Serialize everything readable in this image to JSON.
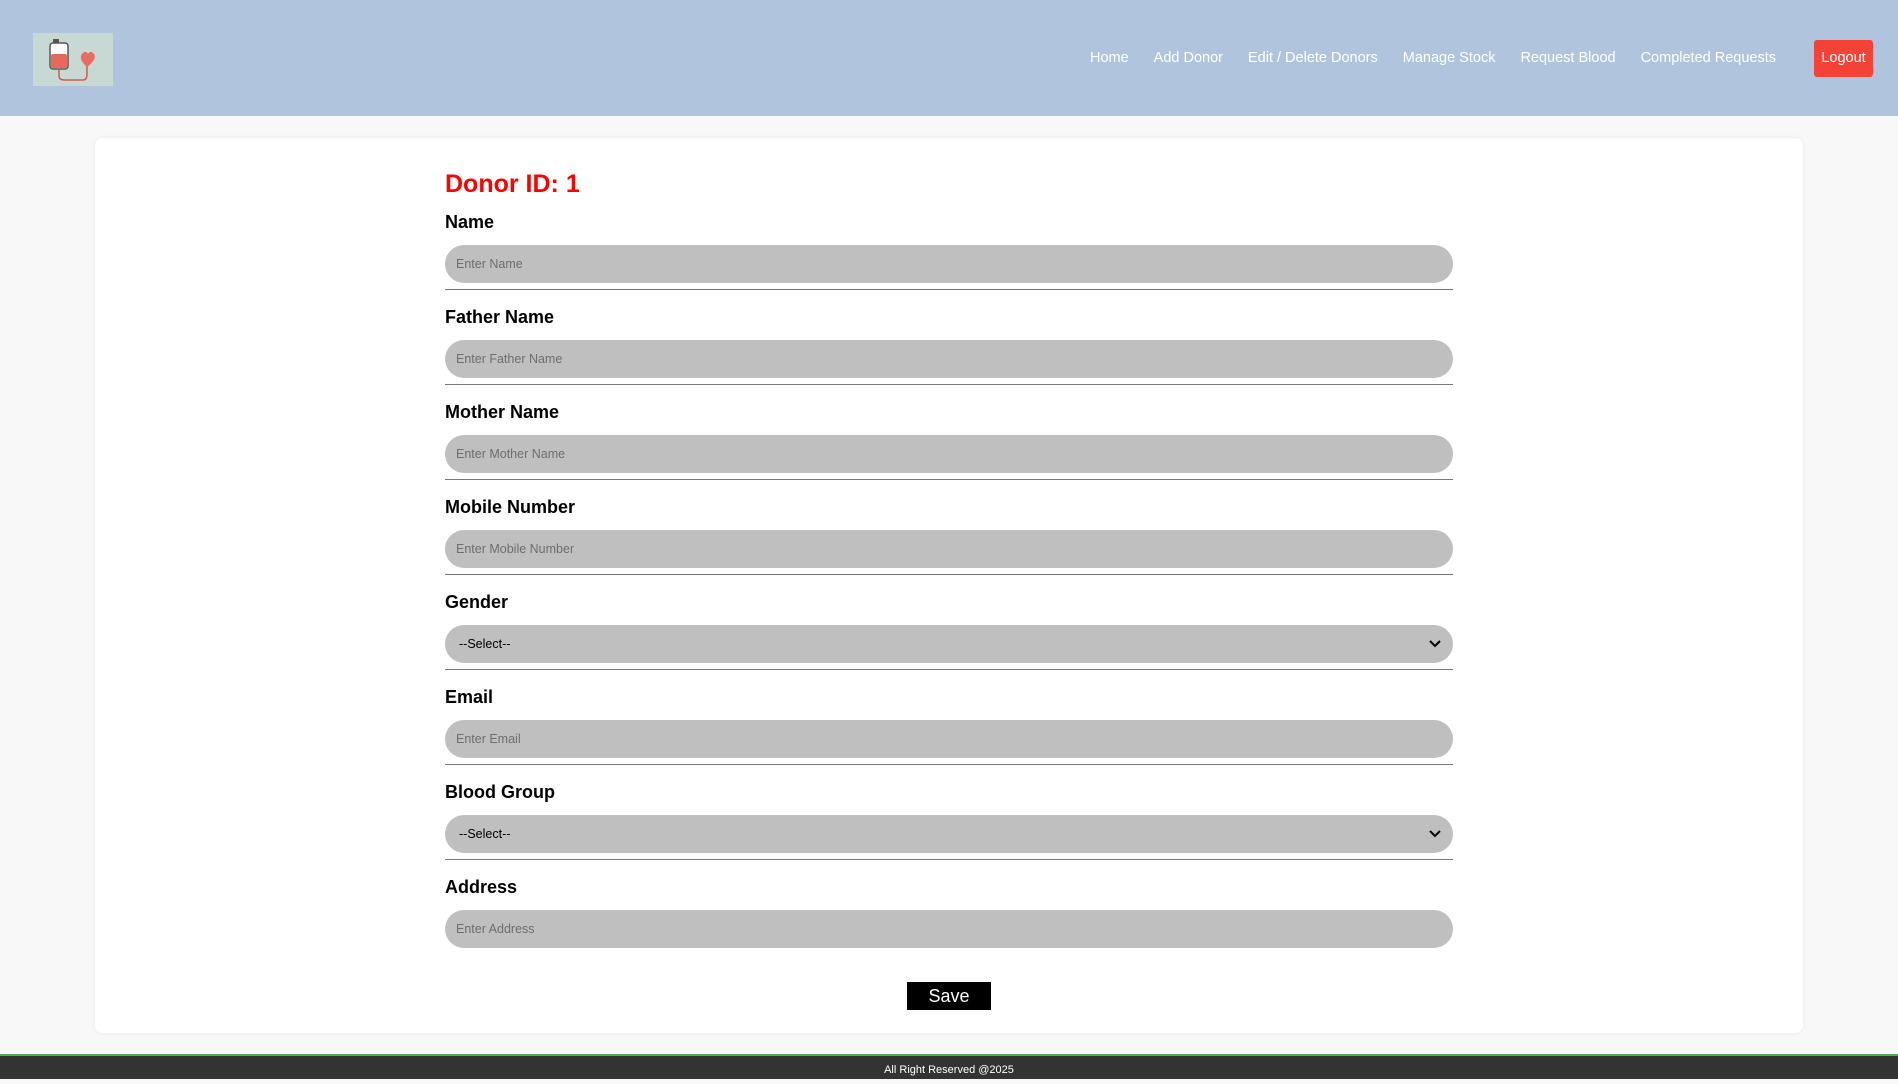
{
  "nav": {
    "items": [
      "Home",
      "Add Donor",
      "Edit / Delete Donors",
      "Manage Stock",
      "Request Blood",
      "Completed Requests"
    ],
    "logout_label": "Logout"
  },
  "form": {
    "donor_id": "Donor ID: 1",
    "fields": [
      {
        "label": "Name",
        "placeholder": "Enter Name",
        "type": "input"
      },
      {
        "label": "Father Name",
        "placeholder": "Enter Father Name",
        "type": "input"
      },
      {
        "label": "Mother Name",
        "placeholder": "Enter Mother Name",
        "type": "input"
      },
      {
        "label": "Mobile Number",
        "placeholder": "Enter Mobile Number",
        "type": "input"
      },
      {
        "label": "Gender",
        "value": "--Select--",
        "type": "select"
      },
      {
        "label": "Email",
        "placeholder": "Enter Email",
        "type": "input"
      },
      {
        "label": "Blood Group",
        "value": "--Select--",
        "type": "select"
      },
      {
        "label": "Address",
        "placeholder": "Enter Address",
        "type": "input"
      }
    ],
    "save_label": "Save"
  },
  "footer": {
    "text": "All Right Reserved @2025"
  },
  "colors": {
    "header_bg": "#b0c4de",
    "logout_bg": "#f44336",
    "donor_id": "#ff0000",
    "input_bg": "#bfbfbf",
    "footer_bg": "#333333",
    "footer_border": "#4caf50"
  },
  "icons": {
    "logo": "blood-bag-heart-icon",
    "select": "chevron-down-icon"
  }
}
